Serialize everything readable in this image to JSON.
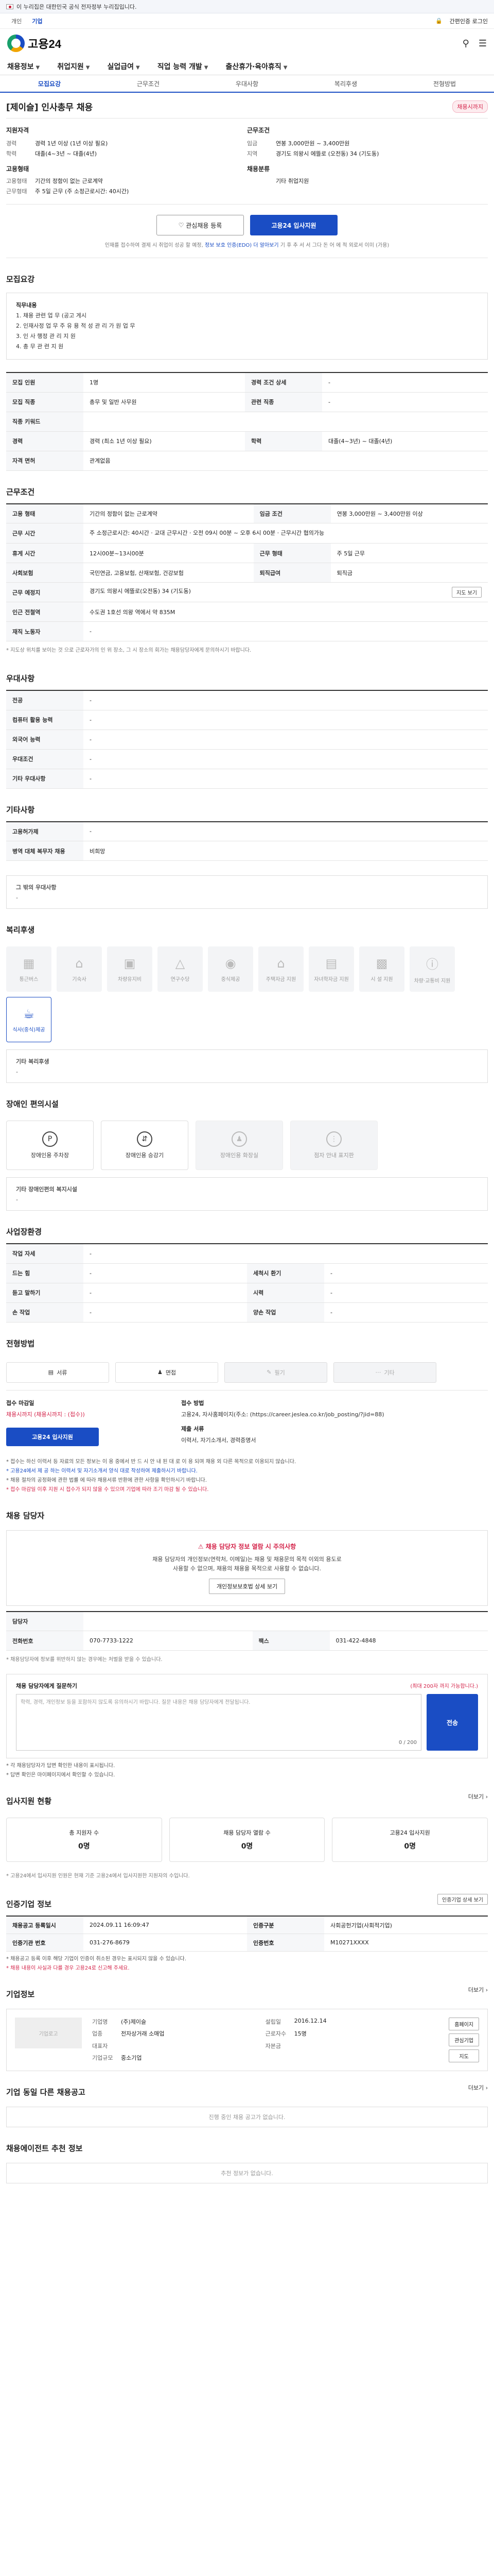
{
  "gov_banner": {
    "text": "이 누리집은 대한민국 공식 전자정부 누리집입니다.",
    "link": ""
  },
  "util": {
    "tab_personal": "개인",
    "tab_corp": "기업",
    "login": "간편인증 로그인",
    "menu_all": "전체메뉴"
  },
  "header": {
    "logo": "고용24"
  },
  "gnb": [
    "채용정보",
    "취업지원",
    "실업급여",
    "직업 능력 개발",
    "출산휴가·육아휴직"
  ],
  "sec_tabs": [
    "모집요강",
    "근무조건",
    "우대사항",
    "복리후생",
    "전형방법"
  ],
  "job": {
    "title": "[제이슬] 인사총무 채용",
    "badge": "채용시까지"
  },
  "summary": {
    "left_title": "지원자격",
    "left": [
      {
        "k": "경력",
        "v": "경력 1년 이상 (1년 이상 필요)"
      },
      {
        "k": "학력",
        "v": "대졸(4~3년 ~ 대졸(4년)"
      }
    ],
    "left_title2": "고용형태",
    "left2": [
      {
        "k": "고용형태",
        "v": "기간의 정함이 없는 근로계약"
      },
      {
        "k": "근무형태",
        "v": "주 5일 근무 (주 소정근로시간: 40시간)"
      }
    ],
    "right_title": "근무조건",
    "right": [
      {
        "k": "임금",
        "v": "연봉 3,000만원 ~ 3,400만원"
      },
      {
        "k": "지역",
        "v": "경기도 의왕시 에뜰로 (오전동) 34 (기도동)"
      }
    ],
    "right_title2": "채용분류",
    "right2": [
      {
        "k": "",
        "v": "기타 취업지원"
      }
    ]
  },
  "actions": {
    "scrap": "관심채용 등록",
    "apply": "고용24 입사지원"
  },
  "actions_note": {
    "pre": "인재를 접수하여 결제 시 취업이 성공 할 예정, ",
    "link": "정보 보호 인증(EDO) 더 알아보기",
    "post": " 기 후 추 서 서 그다 돈 어 에 적 외로서 이미 (가용)"
  },
  "sec_recruit": {
    "title": "모집요강",
    "duty_label": "직무내용",
    "duties": [
      "1. 채용 관련 업 무 (공고 게시",
      "2. 인재사정 업 무 주 유 용 적 성 관 리 가 원 업 무",
      "3. 인 사 행정 관 리 지 원",
      "4. 총 무 관 련 지 원"
    ],
    "rows": [
      {
        "k": "모집 인원",
        "v": "1명",
        "k2": "경력 조건 상세",
        "v2": "-"
      },
      {
        "k": "모집 직종",
        "v": "총무 및 일반 사무원",
        "k2": "관련 직종",
        "v2": "-"
      },
      {
        "k": "직종 키워드",
        "v": "",
        "k2": "",
        "v2": ""
      },
      {
        "k": "경력",
        "v": "경력 (최소 1년 이상 필요)",
        "k2": "학력",
        "v2": "대졸(4~3년) ~ 대졸(4년)"
      },
      {
        "k": "자격 면허",
        "v": "관계없음",
        "k2": "",
        "v2": ""
      }
    ]
  },
  "sec_cond": {
    "title": "근무조건",
    "rows": [
      {
        "k": "고용 형태",
        "v": "기간의 정함이 없는 근로계약",
        "k2": "임금 조건",
        "v2": "연봉 3,000만원 ~ 3,400만원 이상"
      },
      {
        "k": "근무 시간",
        "v": "주 소정근로시간: 40시간 · 교대 근무시간 · 오전 09시 00분 ~ 오후 6시 00분 · 근무시간 협의가능",
        "k2": "",
        "v2": ""
      },
      {
        "k": "휴게 시간",
        "v": "12시00분~13시00분",
        "k2": "근무 형태",
        "v2": "주 5일 근무"
      },
      {
        "k": "사회보험",
        "v": "국민연금, 고용보험, 산재보험, 건강보험",
        "k2": "퇴직급여",
        "v2": "퇴직금"
      },
      {
        "k": "근무 예정지",
        "v": "경기도 의왕시 에뜰로(오전동) 34 (기도동)",
        "k2": "",
        "v2": ""
      },
      {
        "k": "인근 전철역",
        "v": "수도권 1호선 의왕 역에서 약 835M",
        "k2": "",
        "v2": ""
      },
      {
        "k": "재직 노동자",
        "v": "-",
        "k2": "",
        "v2": ""
      }
    ],
    "map_btn": "지도 보기",
    "note": "* 지도상 위치를 보이는 것 으로 근로자가의 인 위 장소, 그 시 장소의 회가는 채용담당자에게 문의하시기 바랍니다."
  },
  "sec_pref": {
    "title": "우대사항",
    "rows": [
      {
        "k": "전공",
        "v": "-"
      },
      {
        "k": "컴퓨터 활용 능력",
        "v": "-"
      },
      {
        "k": "외국어 능력",
        "v": "-"
      },
      {
        "k": "우대조건",
        "v": "-"
      },
      {
        "k": "기타 우대사항",
        "v": "-"
      }
    ]
  },
  "sec_etc": {
    "title": "기타사항",
    "rows": [
      {
        "k": "고용허가제",
        "v": "-"
      },
      {
        "k": "병역 대체 복무자 채용",
        "v": "비희망"
      }
    ],
    "box_title": "그 밖의 우대사항",
    "box_value": "-"
  },
  "sec_welfare": {
    "title": "복리후생",
    "items": [
      {
        "label": "통근버스",
        "icon": "bus-icon",
        "on": false
      },
      {
        "label": "기숙사",
        "icon": "home-icon",
        "on": false
      },
      {
        "label": "차량유지비",
        "icon": "car-icon",
        "on": false
      },
      {
        "label": "연구수당",
        "icon": "flask-icon",
        "on": false
      },
      {
        "label": "중식제공",
        "icon": "meal-icon",
        "on": false
      },
      {
        "label": "주택자금 지원",
        "icon": "house-icon",
        "on": false
      },
      {
        "label": "자녀학자금 지원",
        "icon": "book-icon",
        "on": false
      },
      {
        "label": "시 설 지원",
        "icon": "building-icon",
        "on": false
      },
      {
        "label": "차량·교통비 지원",
        "icon": "info-icon",
        "on": false
      },
      {
        "label": "식사(중식)제공",
        "icon": "cup-icon",
        "on": true
      }
    ],
    "etc_title": "기타 복리후생",
    "etc_value": "-"
  },
  "sec_disab": {
    "title": "장애인 편의시설",
    "items": [
      {
        "label": "장애인용 주차장",
        "on": true
      },
      {
        "label": "장애인용 승강기",
        "on": true
      },
      {
        "label": "장애인용 화장실",
        "on": false
      },
      {
        "label": "점자 안내 표지판",
        "on": false
      }
    ],
    "etc_title": "기타 장애인편의 복지시설",
    "etc_value": "-"
  },
  "sec_workplace": {
    "title": "사업장환경",
    "rows": [
      {
        "k": "작업 자세",
        "v": "-",
        "k2": "",
        "v2": ""
      },
      {
        "k": "드는 힘",
        "v": "-",
        "k2": "세척시 환기",
        "v2": "-"
      },
      {
        "k": "듣고 말하기",
        "v": "-",
        "k2": "시력",
        "v2": "-"
      },
      {
        "k": "손 작업",
        "v": "-",
        "k2": "양손 작업",
        "v2": "-"
      }
    ]
  },
  "sec_process": {
    "title": "전형방법",
    "methods": [
      {
        "label": "서류",
        "on": true
      },
      {
        "label": "면접",
        "on": true
      },
      {
        "label": "필기",
        "on": false
      },
      {
        "label": "기타",
        "on": false
      }
    ],
    "apply_method_title": "접수 마감일",
    "apply_deadline": "채용시까지 (채용시까지 : (접수))",
    "apply_channel_title": "접수 방법",
    "apply_channel": "고용24, 자사홈페이지(주소: (https://career.jeslea.co.kr/job_posting/?jid=88)",
    "submit_title": "제출 서류",
    "submit_docs": "이력서, 자기소개서, 경력증명서",
    "apply_btn": "고용24 입사지원",
    "notes": [
      "* 접수는 하신 이력서 등 자료의 모든 정보는 이 용 중에서 반 드 시 안 내 된 대 로 이 용 되며 채용 외 다른 목적으로 이용되지 않습니다.",
      "* 고용24에서 제 공 하는 이력서 및 자기소개서 양식 대로 작성하여 제출하시기 바랍니다.",
      "* 채용 절차의 공정화에 관한 법률 에 따라 채용서류 반환에 관한 사항을 확인하시기 바랍니다.",
      "* 접수 마감일 이후 지원 시 접수가 되지 않을 수 있으며 기업에 따라 조기 마감 될 수 있습니다."
    ]
  },
  "sec_contact": {
    "title": "채용 담당자",
    "alert_title": "채용 담당자 정보 열람 시 주의사항",
    "alert_lines": [
      "채용 담당자의 개인정보(연락처, 이메일)는 채용 및 채용문의 목적 이외의 용도로",
      "사용할 수 없으며, 채용의 채용을 목적으로 사용할 수 없습니다."
    ],
    "alert_btn": "개인정보보호법 상세 보기",
    "rows": [
      {
        "k": "담당자",
        "v": "",
        "k2": "",
        "v2": ""
      },
      {
        "k": "전화번호",
        "v": "070-7733-1222",
        "k2": "팩스",
        "v2": "031-422-4848"
      }
    ],
    "contact_note": "* 채용담당자에 정보를 위반하지 않는 경우에는 처벌을 받을 수 있습니다.",
    "msg_title": "채용 담당자에게 질문하기",
    "msg_count": "(최대 200자 까지 가능합니다.)",
    "msg_placeholder": "학력, 경력, 개인정보 등을 포함하지 않도록 유의하시기 바랍니다. 질문 내용은 채용 담당자에게 전달됩니다.",
    "msg_counter": "0 / 200",
    "msg_send": "전송",
    "msg_notes": [
      "* 각 채용담당자가 답변 확인한 내용이 표시됩니다.",
      "* 답변 확인은 마이페이지에서 확인할 수 있습니다."
    ]
  },
  "sec_status": {
    "title": "입사지원 현황",
    "more": "더보기",
    "cards": [
      {
        "label": "총 지원자 수",
        "value": "0명"
      },
      {
        "label": "채용 담당자 열람 수",
        "value": "0명"
      },
      {
        "label": "고용24 입사지원",
        "value": "0명"
      }
    ],
    "note": "* 고용24에서 입사지원 인원은 현재 기준 고용24에서 입사지원한 지원자의 수입니다."
  },
  "sec_cert": {
    "title": "인증기업 정보",
    "btn": "인증기업 상세 보기",
    "rows": [
      {
        "k": "채용공고 등록일시",
        "v": "2024.09.11 16:09:47",
        "k2": "인증구분",
        "v2": "사회공헌기업(사회적기업)"
      },
      {
        "k": "인증기관 번호",
        "v": "031-276-8679",
        "k2": "인증번호",
        "v2": "M10271XXXX"
      }
    ],
    "notes": [
      "* 채용공고 등록 이후 해당 기업이 인증이 취소된 경우는 표시되지 않을 수 있습니다.",
      "* 채용 내용이 사실과 다를 경우 고용24로 신고해 주세요."
    ]
  },
  "sec_company": {
    "title": "기업정보",
    "more": "더보기",
    "logo_alt": "기업로고",
    "info": [
      {
        "k": "기업명",
        "v": "(주)제이슬"
      },
      {
        "k": "설립일",
        "v": "2016.12.14"
      },
      {
        "k": "업종",
        "v": "전자상거래 소매업"
      },
      {
        "k": "근로자수",
        "v": "15명"
      },
      {
        "k": "대표자",
        "v": ""
      },
      {
        "k": "자본금",
        "v": ""
      },
      {
        "k": "기업규모",
        "v": "중소기업"
      },
      {
        "k": "",
        "v": ""
      }
    ],
    "btns": [
      "홈페이지",
      "관심기업",
      "지도"
    ]
  },
  "sec_other_jobs": {
    "title": "기업 동일 다른 채용공고",
    "more": "더보기",
    "empty": "진행 중인 채용 공고가 없습니다."
  },
  "sec_recommend": {
    "title": "채용에이전트 추천 정보",
    "empty": "추천 정보가 없습니다."
  }
}
